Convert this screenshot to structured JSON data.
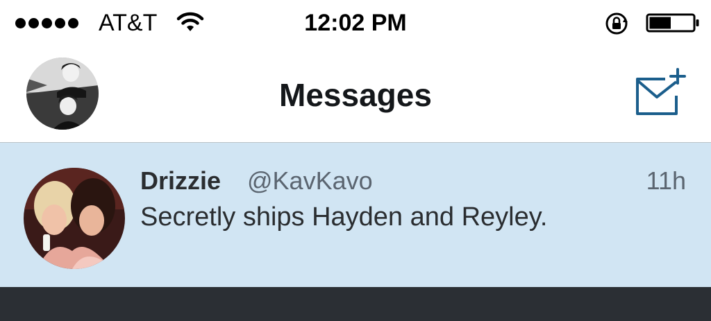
{
  "status_bar": {
    "signal_bars": 5,
    "carrier": "AT&T",
    "time": "12:02 PM",
    "battery_level": 0.5,
    "icons": [
      "signal-icon",
      "wifi-icon",
      "orientation-lock-icon",
      "battery-icon"
    ]
  },
  "nav": {
    "title": "Messages",
    "icons": [
      "profile-avatar",
      "compose-message-icon"
    ]
  },
  "conversations": [
    {
      "name": "Drizzie",
      "handle": "@KavKavo",
      "time": "11h",
      "preview": "Secretly ships Hayden and Reyley."
    }
  ],
  "colors": {
    "accent": "#1b5e8c",
    "row_bg": "#d1e5f3",
    "bottom_bar": "#2b2f34",
    "title": "#14171a"
  }
}
